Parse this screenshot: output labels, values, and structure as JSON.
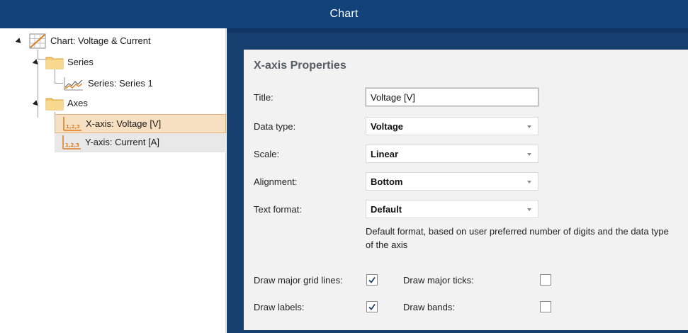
{
  "window": {
    "title": "Chart"
  },
  "tree": {
    "root": {
      "label": "Chart: Voltage & Current",
      "icon": "chart-icon"
    },
    "series_folder": {
      "label": "Series",
      "icon": "folder-icon"
    },
    "series_item": {
      "label": "Series:  Series 1",
      "icon": "line-graph-icon"
    },
    "axes_folder": {
      "label": "Axes",
      "icon": "folder-icon"
    },
    "x_axis": {
      "label": "X-axis:  Voltage [V]",
      "icon": "axis-123-icon",
      "selected": true
    },
    "y_axis": {
      "label": "Y-axis:  Current [A]",
      "icon": "axis-123-icon"
    }
  },
  "properties": {
    "heading": "X-axis Properties",
    "title": {
      "label": "Title:",
      "value": "Voltage [V]"
    },
    "data_type": {
      "label": "Data type:",
      "value": "Voltage"
    },
    "scale": {
      "label": "Scale:",
      "value": "Linear"
    },
    "alignment": {
      "label": "Alignment:",
      "value": "Bottom"
    },
    "text_format": {
      "label": "Text format:",
      "value": "Default"
    },
    "help_text": "Default format, based on user preferred number of digits and the data type of the axis",
    "draw_major_grid_lines": {
      "label": "Draw major grid lines:",
      "checked": true
    },
    "draw_major_ticks": {
      "label": "Draw major ticks:",
      "checked": false
    },
    "draw_labels": {
      "label": "Draw labels:",
      "checked": true
    },
    "draw_bands": {
      "label": "Draw bands:",
      "checked": false
    }
  },
  "colors": {
    "titlebar": "#12427a",
    "content_background": "#163f6f",
    "selected_row": "#f7dfc2",
    "selected_border": "#e2b07a",
    "axis_icon_orange": "#e07b1a"
  }
}
